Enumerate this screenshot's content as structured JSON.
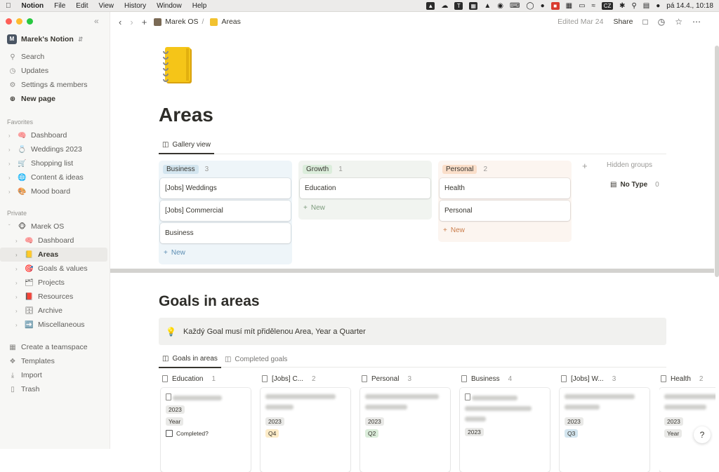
{
  "menubar": {
    "app_name": "Notion",
    "items": [
      "File",
      "Edit",
      "View",
      "History",
      "Window",
      "Help"
    ],
    "right_icons": [
      "antivirus-icon",
      "cloud-icon",
      "t-app-icon",
      "window-icon",
      "cap-icon",
      "vpn-icon",
      "keyboard-icon",
      "camera-icon",
      "app-icon",
      "red-app-icon",
      "grid-icon",
      "battery-icon",
      "wifi-icon",
      "bluetooth-icon",
      "search-icon",
      "control-center-icon",
      "siri-icon"
    ],
    "lang": "CZ",
    "clock": "pá 14.4., 10:18"
  },
  "sidebar": {
    "workspace": "Marek's Notion",
    "workspace_initial": "M",
    "top_items": [
      {
        "label": "Search",
        "icon": "search-icon"
      },
      {
        "label": "Updates",
        "icon": "clock-icon"
      },
      {
        "label": "Settings & members",
        "icon": "gear-icon"
      },
      {
        "label": "New page",
        "icon": "plus-circle-icon"
      }
    ],
    "favorites_label": "Favorites",
    "favorites": [
      {
        "label": "Dashboard",
        "emoji": "🧠"
      },
      {
        "label": "Weddings 2023",
        "emoji": "💍"
      },
      {
        "label": "Shopping list",
        "emoji": "🛒"
      },
      {
        "label": "Content & ideas",
        "emoji": "🌐"
      },
      {
        "label": "Mood board",
        "emoji": "🎨"
      }
    ],
    "private_label": "Private",
    "private_root": {
      "label": "Marek OS",
      "emoji": "🐵"
    },
    "private_children": [
      {
        "label": "Dashboard",
        "emoji": "🧠"
      },
      {
        "label": "Areas",
        "emoji": "📒"
      },
      {
        "label": "Goals & values",
        "emoji": "🎯"
      },
      {
        "label": "Projects",
        "emoji": "🗂"
      },
      {
        "label": "Resources",
        "emoji": "📕"
      },
      {
        "label": "Archive",
        "emoji": "🗄"
      },
      {
        "label": "Miscellaneous",
        "emoji": "➡️"
      }
    ],
    "bottom_items": [
      {
        "label": "Create a teamspace",
        "icon": "teamspace-icon"
      },
      {
        "label": "Templates",
        "icon": "templates-icon"
      },
      {
        "label": "Import",
        "icon": "import-icon"
      },
      {
        "label": "Trash",
        "icon": "trash-icon"
      }
    ]
  },
  "topbar": {
    "breadcrumb_root": "Marek OS",
    "breadcrumb_sep": "/",
    "breadcrumb_page": "Areas",
    "edited": "Edited Mar 24",
    "share": "Share"
  },
  "page": {
    "title": "Areas",
    "view_tab": "Gallery view",
    "groups": [
      {
        "name": "Business",
        "count": "3",
        "color": "#e7f3f8",
        "pill": "#d3e5ef",
        "cards": [
          "[Jobs] Weddings",
          "[Jobs] Commercial",
          "Business"
        ]
      },
      {
        "name": "Growth",
        "count": "1",
        "color": "#eef3ed",
        "pill": "#dbeddb",
        "cards": [
          "Education"
        ]
      },
      {
        "name": "Personal",
        "count": "2",
        "color": "#fbf3ee",
        "pill": "#fadec9",
        "cards": [
          "Health",
          "Personal"
        ]
      }
    ],
    "new_label": "New",
    "hidden_groups": "Hidden groups",
    "no_type": "No Type",
    "no_type_count": "0"
  },
  "goals": {
    "title": "Goals in areas",
    "callout": "Každý Goal musí mít přidělenou Area, Year a Quarter",
    "tabs": [
      "Goals in areas",
      "Completed goals"
    ],
    "columns": [
      {
        "name": "Education",
        "count": "1",
        "year": "2023",
        "extra": "Year",
        "completed": "Completed?"
      },
      {
        "name": "[Jobs] C...",
        "count": "2",
        "year": "2023",
        "extra": "Q4"
      },
      {
        "name": "Personal",
        "count": "3",
        "year": "2023",
        "extra": "Q2"
      },
      {
        "name": "Business",
        "count": "4",
        "year": "2023",
        "extra": ""
      },
      {
        "name": "[Jobs] W...",
        "count": "3",
        "year": "2023",
        "extra": "Q3"
      },
      {
        "name": "Health",
        "count": "2",
        "year": "2023",
        "extra": "Year"
      }
    ]
  },
  "help": "?"
}
